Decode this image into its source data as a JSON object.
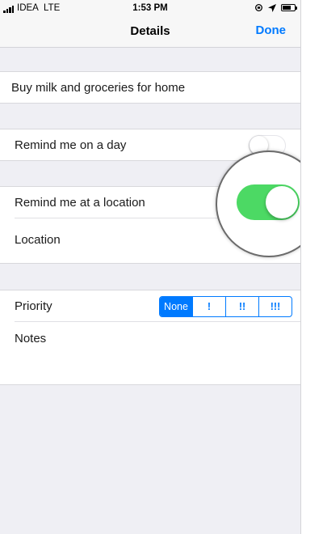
{
  "status_bar": {
    "carrier": "IDEA",
    "network": "LTE",
    "time": "1:53 PM"
  },
  "nav": {
    "title": "Details",
    "done_label": "Done"
  },
  "task": {
    "title": "Buy milk and groceries for home"
  },
  "remind_day": {
    "label": "Remind me on a day",
    "enabled": false
  },
  "remind_location": {
    "label": "Remind me at a location",
    "enabled": true
  },
  "location": {
    "label": "Location"
  },
  "priority": {
    "label": "Priority",
    "options": [
      "None",
      "!",
      "!!",
      "!!!"
    ],
    "selected": "None"
  },
  "notes": {
    "label": "Notes"
  },
  "colors": {
    "accent": "#007aff",
    "toggle_on": "#4cd964",
    "background": "#efeff4"
  }
}
